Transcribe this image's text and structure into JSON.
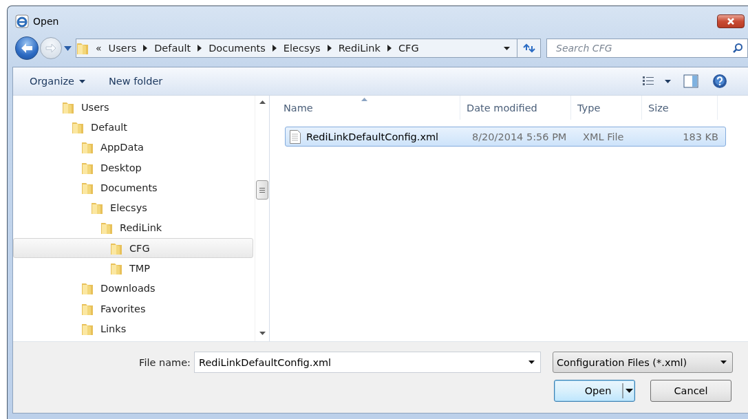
{
  "window": {
    "title": "Open"
  },
  "address": {
    "overflow": "«",
    "crumbs": [
      "Users",
      "Default",
      "Documents",
      "Elecsys",
      "RediLink",
      "CFG"
    ]
  },
  "search": {
    "placeholder": "Search CFG"
  },
  "toolbar": {
    "buttons": [
      {
        "label": "Organize",
        "kind": "menu"
      },
      {
        "label": "New folder",
        "kind": "plain"
      }
    ]
  },
  "tree": {
    "items": [
      {
        "label": "Users",
        "selected": false,
        "children": [
          {
            "label": "Default",
            "selected": false,
            "children": [
              {
                "label": "AppData",
                "selected": false
              },
              {
                "label": "Desktop",
                "selected": false
              },
              {
                "label": "Documents",
                "selected": false,
                "children": [
                  {
                    "label": "Elecsys",
                    "selected": false,
                    "children": [
                      {
                        "label": "RediLink",
                        "selected": false,
                        "children": [
                          {
                            "label": "CFG",
                            "selected": true
                          },
                          {
                            "label": "TMP",
                            "selected": false
                          }
                        ]
                      }
                    ]
                  }
                ]
              },
              {
                "label": "Downloads",
                "selected": false
              },
              {
                "label": "Favorites",
                "selected": false
              },
              {
                "label": "Links",
                "selected": false
              }
            ]
          }
        ]
      }
    ]
  },
  "files": {
    "columns": [
      {
        "label": "Name",
        "sorted": true
      },
      {
        "label": "Date modified",
        "sorted": false
      },
      {
        "label": "Type",
        "sorted": false
      },
      {
        "label": "Size",
        "sorted": false
      }
    ],
    "rows": [
      {
        "name": "RediLinkDefaultConfig.xml",
        "date": "8/20/2014 5:56 PM",
        "type": "XML File",
        "size": "183 KB",
        "selected": true
      }
    ]
  },
  "footer": {
    "file_name_label": "File name:",
    "file_name": "RediLinkDefaultConfig.xml",
    "filter": "Configuration Files (*.xml)",
    "buttons": [
      {
        "label": "Open",
        "kind": "split"
      },
      {
        "label": "Cancel",
        "kind": "plain"
      }
    ]
  }
}
